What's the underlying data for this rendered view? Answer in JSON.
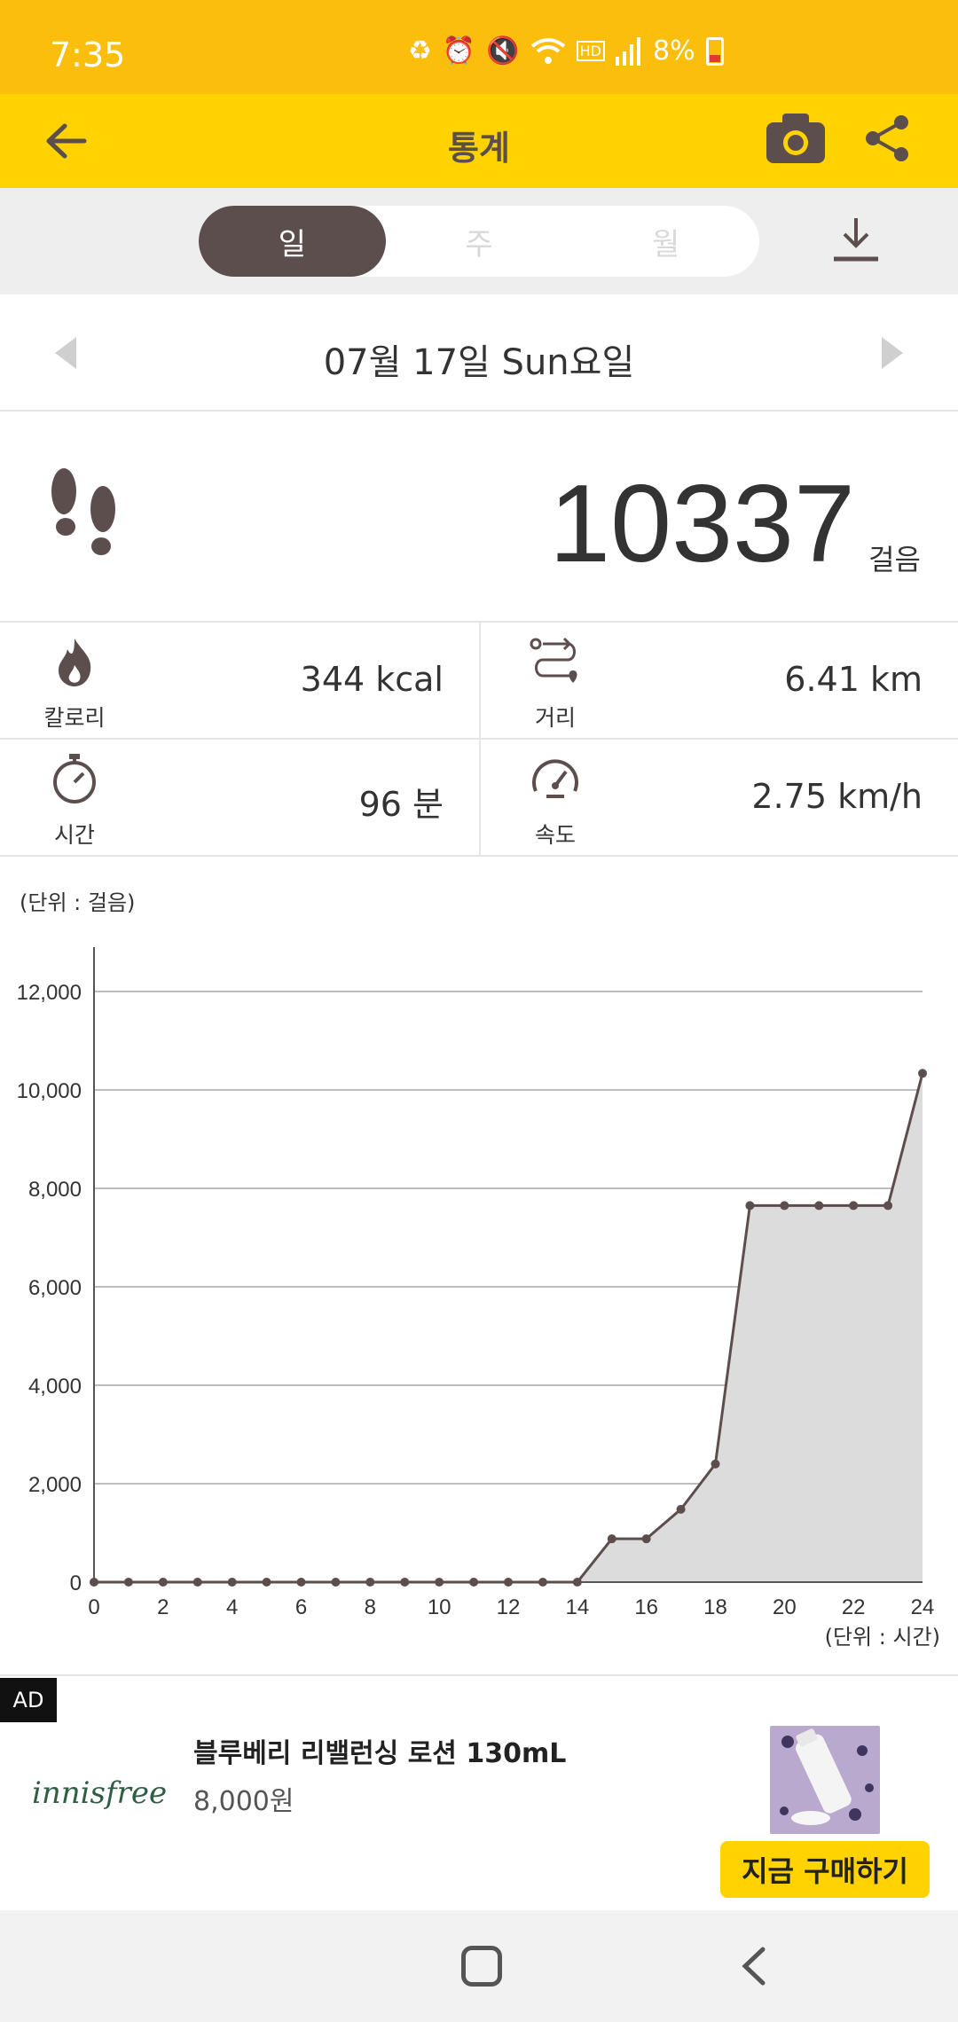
{
  "status_bar": {
    "time": "7:35",
    "battery": "8%",
    "icons": [
      "recycle-icon",
      "alarm-icon",
      "mute-icon",
      "wifi-icon",
      "hd-voice-icon",
      "signal-icon",
      "battery-icon"
    ]
  },
  "app_bar": {
    "title": "통계",
    "icons": [
      "back-arrow-icon",
      "camera-icon",
      "share-icon"
    ]
  },
  "tabs": [
    {
      "label": "일",
      "active": true
    },
    {
      "label": "주",
      "active": false
    },
    {
      "label": "월",
      "active": false
    }
  ],
  "date": {
    "text": "07월 17일 Sun요일"
  },
  "steps": {
    "value": "10337",
    "unit": "걸음"
  },
  "stats": {
    "calories": {
      "label": "칼로리",
      "value": "344 kcal"
    },
    "distance": {
      "label": "거리",
      "value": "6.41 km"
    },
    "time": {
      "label": "시간",
      "value": "96 분"
    },
    "speed": {
      "label": "속도",
      "value": "2.75 km/h"
    }
  },
  "chart_data": {
    "type": "area",
    "y_unit_label": "(단위 : 걸음)",
    "x_unit_label": "(단위 : 시간)",
    "x": [
      0,
      1,
      2,
      3,
      4,
      5,
      6,
      7,
      8,
      9,
      10,
      11,
      12,
      13,
      14,
      15,
      16,
      17,
      18,
      19,
      20,
      21,
      22,
      23,
      24
    ],
    "values": [
      0,
      0,
      0,
      0,
      0,
      0,
      0,
      0,
      0,
      0,
      0,
      0,
      0,
      0,
      0,
      880,
      880,
      1480,
      2400,
      7650,
      7650,
      7650,
      7650,
      7650,
      10337
    ],
    "xlim": [
      0,
      24
    ],
    "ylim": [
      0,
      12000
    ],
    "x_ticks": [
      "0",
      "2",
      "4",
      "6",
      "8",
      "10",
      "12",
      "14",
      "16",
      "18",
      "20",
      "22",
      "24"
    ],
    "x_tick_values": [
      0,
      2,
      4,
      6,
      8,
      10,
      12,
      14,
      16,
      18,
      20,
      22,
      24
    ],
    "y_ticks": [
      "0",
      "2,000",
      "4,000",
      "6,000",
      "8,000",
      "10,000",
      "12,000"
    ],
    "y_tick_values": [
      0,
      2000,
      4000,
      6000,
      8000,
      10000,
      12000
    ],
    "grid": true,
    "line_color": "#5D4E4E",
    "fill_color": "#DDDCDC"
  },
  "ad": {
    "badge": "AD",
    "brand": "innisfree",
    "title": "블루베리 리밸런싱 로션 130mL",
    "price": "8,000원",
    "cta": "지금 구매하기"
  },
  "colors": {
    "status_bar": "#FBBE0C",
    "app_bar": "#FFD200",
    "accent_dark": "#5D4E4E"
  }
}
